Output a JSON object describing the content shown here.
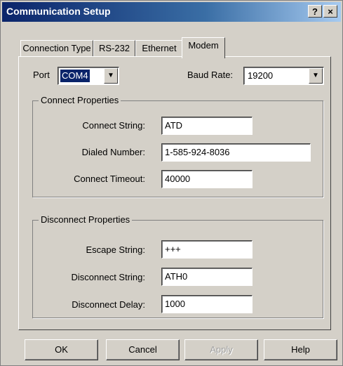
{
  "window": {
    "title": "Communication Setup",
    "help_glyph": "?",
    "close_glyph": "×"
  },
  "tabs": [
    "Connection Type",
    "RS-232",
    "Ethernet",
    "Modem"
  ],
  "active_tab": "Modem",
  "port": {
    "label": "Port",
    "value": "COM4"
  },
  "baud_rate": {
    "label": "Baud Rate:",
    "value": "19200"
  },
  "connect_properties": {
    "title": "Connect Properties",
    "connect_string_label": "Connect String:",
    "connect_string_value": "ATD",
    "dialed_number_label": "Dialed Number:",
    "dialed_number_value": "1-585-924-8036",
    "connect_timeout_label": "Connect Timeout:",
    "connect_timeout_value": "40000"
  },
  "disconnect_properties": {
    "title": "Disconnect Properties",
    "escape_string_label": "Escape String:",
    "escape_string_value": "+++",
    "disconnect_string_label": "Disconnect String:",
    "disconnect_string_value": "ATH0",
    "disconnect_delay_label": "Disconnect Delay:",
    "disconnect_delay_value": "1000"
  },
  "buttons": {
    "ok": "OK",
    "cancel": "Cancel",
    "apply": "Apply",
    "help": "Help"
  },
  "colors": {
    "titlebar": "#0a246a",
    "face": "#d4d0c8",
    "selection": "#0a246a"
  }
}
